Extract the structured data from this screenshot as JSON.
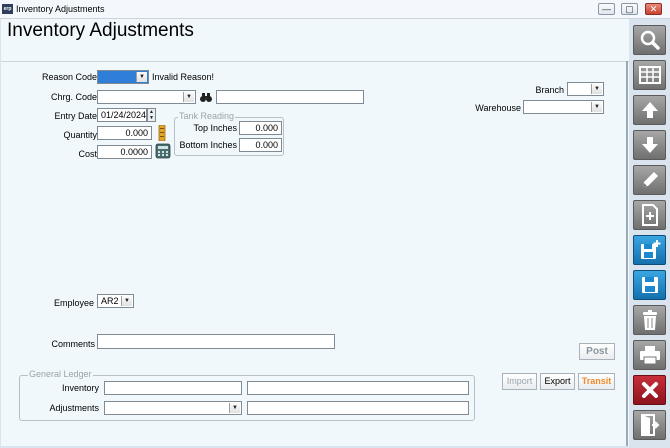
{
  "window": {
    "title": "Inventory Adjustments",
    "buttons": {
      "minimize": "—",
      "maximize": "▢",
      "close": "✕"
    }
  },
  "page": {
    "heading": "Inventory Adjustments"
  },
  "form": {
    "reason_code": {
      "label": "Reason Code",
      "value": "",
      "message": "Invalid Reason!"
    },
    "chrg_code": {
      "label": "Chrg. Code",
      "value": "",
      "description": ""
    },
    "entry_date": {
      "label": "Entry Date",
      "value": "01/24/2024"
    },
    "quantity": {
      "label": "Quantity",
      "value": "0.000"
    },
    "cost": {
      "label": "Cost",
      "value": "0.0000"
    },
    "tank_reading": {
      "title": "Tank Reading",
      "top_label": "Top Inches",
      "top_value": "0.000",
      "bottom_label": "Bottom Inches",
      "bottom_value": "0.000"
    },
    "branch": {
      "label": "Branch",
      "value": ""
    },
    "warehouse": {
      "label": "Warehouse",
      "value": ""
    },
    "employee": {
      "label": "Employee",
      "value": "AR2"
    },
    "comments": {
      "label": "Comments",
      "value": ""
    },
    "general_ledger": {
      "title": "General Ledger",
      "inventory_label": "Inventory",
      "inventory_value": "",
      "inventory_desc": "",
      "adjustments_label": "Adjustments",
      "adjustments_value": "",
      "adjustments_desc": ""
    }
  },
  "actions": {
    "post": "Post",
    "import": "Import",
    "export": "Export",
    "transit": "Transit"
  },
  "toolbar": [
    {
      "name": "search-icon",
      "style": "gray"
    },
    {
      "name": "grid-icon",
      "style": "gray"
    },
    {
      "name": "arrow-up-icon",
      "style": "gray"
    },
    {
      "name": "arrow-down-icon",
      "style": "gray"
    },
    {
      "name": "pencil-icon",
      "style": "gray"
    },
    {
      "name": "new-document-icon",
      "style": "gray"
    },
    {
      "name": "save-new-icon",
      "style": "blue"
    },
    {
      "name": "save-icon",
      "style": "blue"
    },
    {
      "name": "trash-icon",
      "style": "gray"
    },
    {
      "name": "printer-icon",
      "style": "gray"
    },
    {
      "name": "cancel-icon",
      "style": "red"
    },
    {
      "name": "exit-icon",
      "style": "gray"
    }
  ],
  "colors": {
    "accent": "#2f7fd8",
    "transit": "#f08c2c",
    "save_blue": "#1e88cf",
    "cancel_red": "#a81d26"
  }
}
